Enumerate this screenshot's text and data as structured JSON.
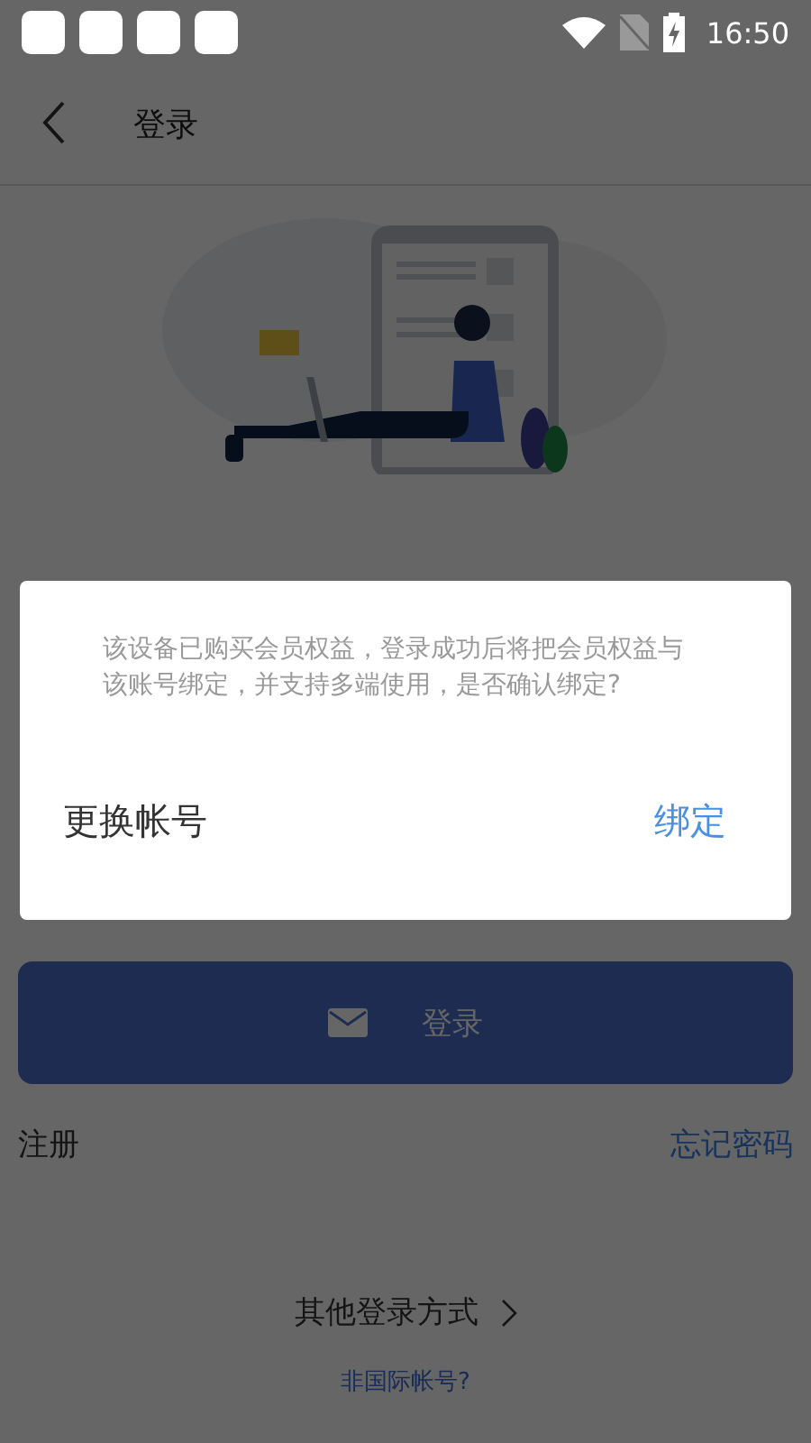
{
  "status_bar": {
    "time": "16:50"
  },
  "header": {
    "title": "登录"
  },
  "login_button": {
    "label": "登录",
    "disabled": true
  },
  "links": {
    "register": "注册",
    "forgot_password": "忘记密码"
  },
  "other_login": "其他登录方式",
  "non_international": "非国际帐号?",
  "dialog": {
    "message": "该设备已购买会员权益，登录成功后将把会员权益与该账号绑定，并支持多端使用，是否确认绑定?",
    "buttons": [
      {
        "label": "更换帐号",
        "kind": "secondary"
      },
      {
        "label": "绑定",
        "kind": "primary"
      }
    ]
  }
}
